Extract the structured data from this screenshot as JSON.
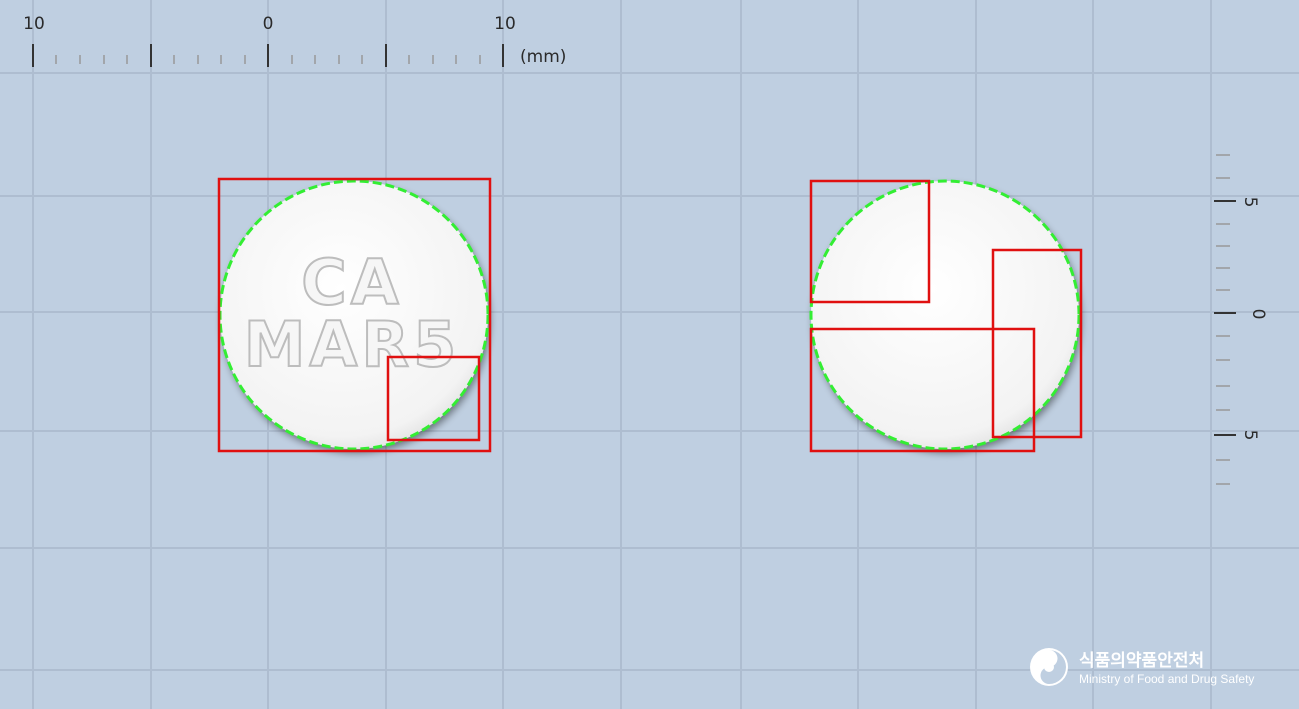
{
  "top_ruler": {
    "labels": [
      "10",
      "0",
      "10"
    ],
    "unit": "(mm)"
  },
  "side_ruler": {
    "labels": [
      "5",
      "0",
      "5"
    ]
  },
  "tablet_front": {
    "imprint_line1": "CA",
    "imprint_line2": "MAR5"
  },
  "logo": {
    "korean": "식품의약품안전처",
    "english": "Ministry of Food and Drug Safety",
    "icon": "mfds-logo-icon"
  },
  "colors": {
    "background": "#bfcfe1",
    "grid": "#aebdd0",
    "tablet": "#f6f6f6",
    "box": "#e01010",
    "outline": "#33ee33"
  }
}
